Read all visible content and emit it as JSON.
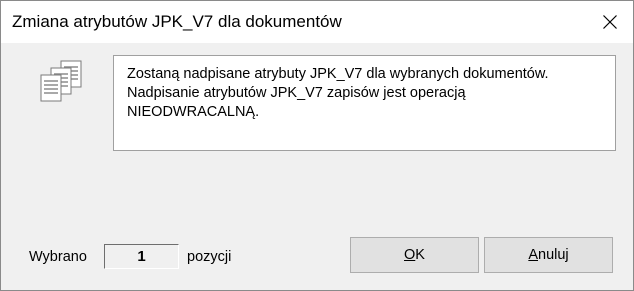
{
  "window": {
    "title": "Zmiana atrybutów JPK_V7 dla dokumentów",
    "close_icon": "close-icon"
  },
  "message": {
    "icon": "documents-icon",
    "line1": "Zostaną nadpisane atrybuty JPK_V7 dla wybranych dokumentów.",
    "line2": "Nadpisanie atrybutów JPK_V7 zapisów jest operacją",
    "line3": "NIEODWRACALNĄ."
  },
  "selection": {
    "label": "Wybrano",
    "count": "1",
    "suffix": "pozycji"
  },
  "buttons": {
    "ok_accel": "O",
    "ok_rest": "K",
    "cancel_accel": "A",
    "cancel_rest": "nuluj"
  },
  "colors": {
    "window_bg": "#f0f0f0",
    "title_bg": "#ffffff",
    "button_bg": "#e1e1e1",
    "button_border": "#adadad"
  }
}
